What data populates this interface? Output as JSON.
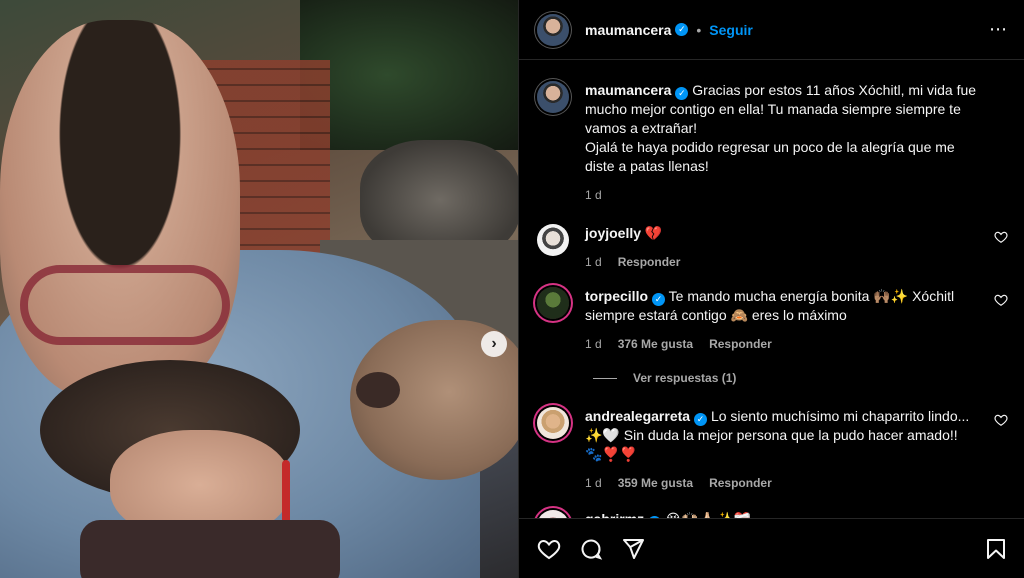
{
  "header": {
    "username": "maumancera",
    "separator": "•",
    "follow_label": "Seguir",
    "more_icon": "⋯"
  },
  "caption": {
    "username": "maumancera",
    "text": "Gracias por estos 11 años Xóchitl, mi vida fue mucho mejor contigo en ella! Tu manada siempre siempre te vamos a extrañar!",
    "text2": "Ojalá te haya podido regresar un poco de la alegría que me diste a patas llenas!",
    "time": "1 d"
  },
  "comments": [
    {
      "username": "joyjoelly",
      "text": "💔",
      "time": "1 d",
      "likes": "",
      "reply": "Responder"
    },
    {
      "username": "torpecillo",
      "text": "Te mando mucha energía bonita 🙌🏽✨ Xóchitl siempre estará contigo 🙈 eres lo máximo",
      "time": "1 d",
      "likes": "376 Me gusta",
      "reply": "Responder"
    },
    {
      "username": "andrealegarreta",
      "text": "Lo siento muchísimo mi chaparrito lindo... ✨🤍 Sin duda la mejor persona que la pudo hacer amado!! 🐾❣️❣️",
      "time": "1 d",
      "likes": "359 Me gusta",
      "reply": "Responder"
    },
    {
      "username": "gabrirmz",
      "text": "😭🙌🏻🙏🏻✨❤️‍🩹"
    }
  ],
  "view_replies": "Ver respuestas (1)",
  "carousel_next": "›",
  "colors": {
    "accent": "#0095f6",
    "background": "#000000",
    "story_ring": "#d63384"
  }
}
